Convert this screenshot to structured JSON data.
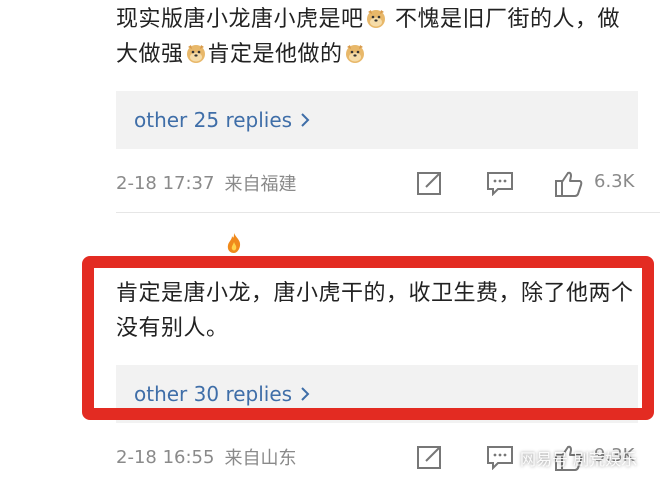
{
  "comments": [
    {
      "text_part1": "现实版唐小龙唐小虎是吧",
      "text_part2": " 不愧是旧厂街的人，做大做强",
      "text_part3": "肯定是他做的",
      "emoji": "doge-face-icon",
      "replies_label": "other 25 replies",
      "time": "2-18 17:37",
      "location": "来自福建",
      "likes": "6.3K"
    },
    {
      "text": "肯定是唐小龙，唐小虎干的，收卫生费，除了他两个没有别人。",
      "replies_label": "other 30 replies",
      "time": "2-18 16:55",
      "location": "来自山东",
      "likes": "9.3K",
      "highlighted": true
    }
  ],
  "icons": {
    "share": "share-icon",
    "reply": "comment-icon",
    "like": "thumbs-up-icon",
    "fire": "fire-icon",
    "chevron": "chevron-right-icon"
  },
  "colors": {
    "link": "#3f6ea8",
    "meta": "#8a8a8a",
    "highlight_border": "#e32b22",
    "replies_bg": "#f2f2f2"
  },
  "watermark": "网易号 剧荒娱乐"
}
